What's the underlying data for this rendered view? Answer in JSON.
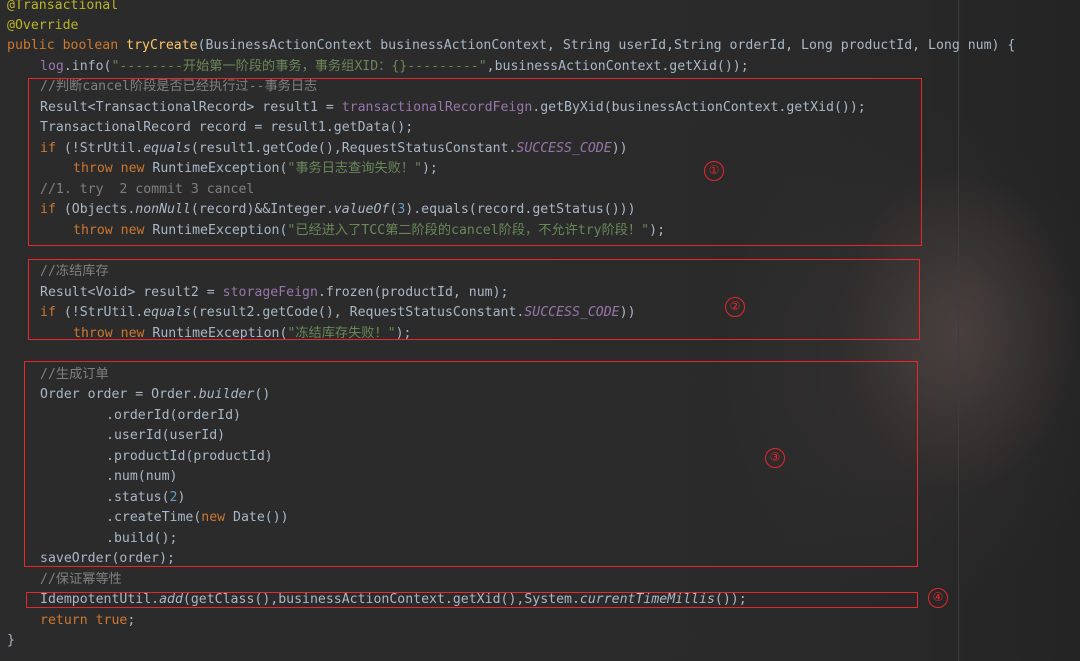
{
  "code": {
    "l1": {
      "ann": "@Transactional"
    },
    "l2": {
      "ann": "@Override"
    },
    "l3": {
      "kw_public": "public",
      "kw_boolean": "boolean",
      "method": "tryCreate",
      "params": "(BusinessActionContext businessActionContext, String userId,String orderId, Long productId, Long num) {"
    },
    "l4": {
      "field": "log",
      "call": ".info(",
      "str": "\"--------开始第一阶段的事务，事务组XID：{}---------\"",
      "rest": ",businessActionContext.getXid());"
    },
    "l5": {
      "comment": "//判断cancel阶段是否已经执行过--事务日志"
    },
    "l6": {
      "pre": "Result<TransactionalRecord> result1 = ",
      "field": "transactionalRecordFeign",
      "rest": ".getByXid(businessActionContext.getXid());"
    },
    "l7": {
      "text": "TransactionalRecord record = result1.getData();"
    },
    "l8": {
      "kw_if": "if",
      "pre": " (!StrUtil.",
      "method": "equals",
      "mid": "(result1.getCode(),RequestStatusConstant.",
      "const": "SUCCESS_CODE",
      "end": "))"
    },
    "l9": {
      "kw_throw": "throw",
      "kw_new": "new",
      "pre": " RuntimeException(",
      "str": "\"事务日志查询失败！\"",
      "end": ");"
    },
    "l10": {
      "comment": "//1. try  2 commit 3 cancel"
    },
    "l11": {
      "kw_if": "if",
      "pre": " (Objects.",
      "method": "nonNull",
      "mid1": "(record)&&Integer.",
      "method2": "valueOf",
      "mid2": "(",
      "num": "3",
      "end": ").equals(record.getStatus()))"
    },
    "l12": {
      "kw_throw": "throw",
      "kw_new": "new",
      "pre": " RuntimeException(",
      "str": "\"已经进入了TCC第二阶段的cancel阶段，不允许try阶段！\"",
      "end": ");"
    },
    "l13": {
      "comment": "//冻结库存"
    },
    "l14": {
      "pre": "Result<Void> result2 = ",
      "field": "storageFeign",
      "rest": ".frozen(productId, num);"
    },
    "l15": {
      "kw_if": "if",
      "pre": " (!StrUtil.",
      "method": "equals",
      "mid": "(result2.getCode(), RequestStatusConstant.",
      "const": "SUCCESS_CODE",
      "end": "))"
    },
    "l16": {
      "kw_throw": "throw",
      "kw_new": "new",
      "pre": " RuntimeException(",
      "str": "\"冻结库存失败！\"",
      "end": ");"
    },
    "l17": {
      "comment": "//生成订单"
    },
    "l18": {
      "pre": "Order order = Order.",
      "method": "builder",
      "end": "()"
    },
    "l19": {
      "text": ".orderId(orderId)"
    },
    "l20": {
      "text": ".userId(userId)"
    },
    "l21": {
      "text": ".productId(productId)"
    },
    "l22": {
      "text": ".num(num)"
    },
    "l23": {
      "pre": ".status(",
      "num": "2",
      "end": ")"
    },
    "l24": {
      "pre": ".createTime(",
      "kw_new": "new",
      "end": " Date())"
    },
    "l25": {
      "text": ".build();"
    },
    "l26": {
      "text": "saveOrder(order);"
    },
    "l27": {
      "comment": "//保证幂等性"
    },
    "l28": {
      "pre": "IdempotentUtil.",
      "method": "add",
      "mid": "(getClass(),businessActionContext.getXid(),System.",
      "method2": "currentTimeMillis",
      "end": "());"
    },
    "l29": {
      "kw_return": "return",
      "kw_true": "true",
      "end": ";"
    },
    "l30": {
      "text": "}"
    }
  },
  "markers": [
    "①",
    "②",
    "③",
    "④"
  ],
  "colors": {
    "annotation_box": "#e8262c",
    "keyword": "#cc7832",
    "string": "#6a8759",
    "comment": "#808080",
    "field": "#9876aa",
    "method_decl": "#ffc66d",
    "number": "#6897bb",
    "default_text": "#a9b7c6"
  }
}
